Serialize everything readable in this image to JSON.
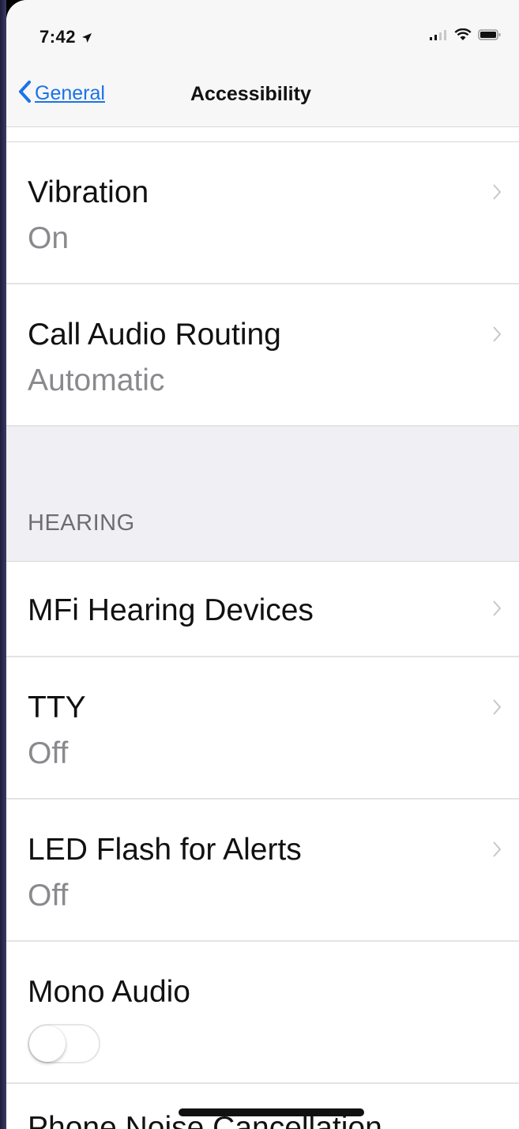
{
  "status_bar": {
    "time": "7:42",
    "location_icon": "location-arrow-icon",
    "signal_icon": "cellular-signal-icon",
    "wifi_icon": "wifi-icon",
    "battery_icon": "battery-icon"
  },
  "nav": {
    "back_label": "General",
    "title": "Accessibility"
  },
  "rows_top": [
    {
      "title": "Vibration",
      "value": "On"
    },
    {
      "title": "Call Audio Routing",
      "value": "Automatic"
    }
  ],
  "section": {
    "header": "HEARING"
  },
  "rows_hearing": [
    {
      "title": "MFi Hearing Devices"
    },
    {
      "title": "TTY",
      "value": "Off"
    },
    {
      "title": "LED Flash for Alerts",
      "value": "Off"
    },
    {
      "title": "Mono Audio",
      "toggle_on": false
    },
    {
      "title": "Phone Noise Cancellation"
    }
  ],
  "colors": {
    "accent": "#1a73e8",
    "secondary_text": "#8a8a8e",
    "section_bg": "#efeff4"
  }
}
